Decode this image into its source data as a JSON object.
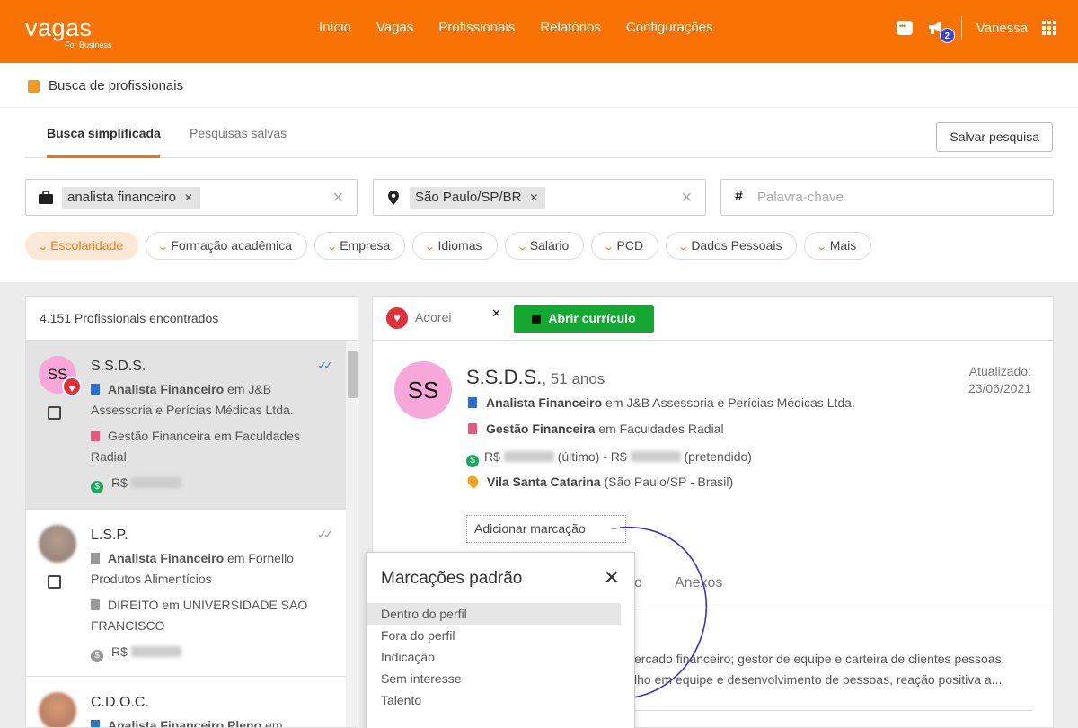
{
  "header": {
    "logo": "vagas",
    "logo_sub": "For Business",
    "nav": [
      "Início",
      "Vagas",
      "Profissionais",
      "Relatórios",
      "Configurações"
    ],
    "notification_count": "2",
    "user": "Vanessa"
  },
  "page": {
    "title": "Busca de profissionais"
  },
  "tabs": {
    "simple": "Busca simplificada",
    "saved": "Pesquisas salvas"
  },
  "save_search_label": "Salvar pesquisa",
  "search": {
    "position_chip": "analista financeiro",
    "location_chip": "São Paulo/SP/BR",
    "keyword_placeholder": "Palavra-chave"
  },
  "filters": [
    "Escolaridade",
    "Formação acadêmica",
    "Empresa",
    "Idiomas",
    "Salário",
    "PCD",
    "Dados Pessoais",
    "Mais"
  ],
  "results": {
    "count_text": "4.151 Profissionais encontrados",
    "items": [
      {
        "initials": "SS",
        "name": "S.S.D.S.",
        "job_title": "Analista Financeiro",
        "job_rest": " em J&B Assessoria e Perícias Médicas Ltda.",
        "education": "Gestão Financeira em Faculdades Radial",
        "currency": "R$"
      },
      {
        "initials": "",
        "name": "L.S.P.",
        "job_title": "Analista Financeiro",
        "job_rest": " em Fornello Produtos Alimentícios",
        "education": "DIREITO em UNIVERSIDADE SAO FRANCISCO",
        "currency": "R$"
      },
      {
        "initials": "",
        "name": "C.D.O.C.",
        "job_title": "Analista Financeiro Pleno",
        "job_rest": " em"
      }
    ]
  },
  "detail": {
    "adorei": "Adorei",
    "open_cv": "Abrir currículo",
    "initials": "SS",
    "name": "S.S.D.S.",
    "age": ", 51 anos",
    "updated_label": "Atualizado:",
    "updated_date": "23/06/2021",
    "job_title": "Analista Financeiro",
    "job_rest": " em J&B Assessoria e Perícias Médicas Ltda.",
    "education_title": "Gestão Financeira",
    "education_rest": " em Faculdades Radial",
    "salary_prefix": "R$",
    "salary_last": "(último) - R$",
    "salary_wanted": "(pretendido)",
    "location_bold": "Vila Santa Catarina",
    "location_rest": " (São Paulo/SP - Brasil)",
    "add_tag": "Adicionar marcação",
    "tab_partial": "o",
    "tab_attachments": "Anexos",
    "summary_line1": "ercado financeiro; gestor de equipe e carteira de clientes pessoas",
    "summary_line2": "lho em equipe e desenvolvimento de pessoas, reação positiva a..."
  },
  "popup": {
    "title": "Marcações padrão",
    "items": [
      "Dentro do perfil",
      "Fora do perfil",
      "Indicação",
      "Sem interesse",
      "Talento"
    ]
  },
  "colors": {
    "brand": "#f97304",
    "green": "#14a832",
    "heart": "#e0303a",
    "annotation": "#3d2bd6"
  }
}
